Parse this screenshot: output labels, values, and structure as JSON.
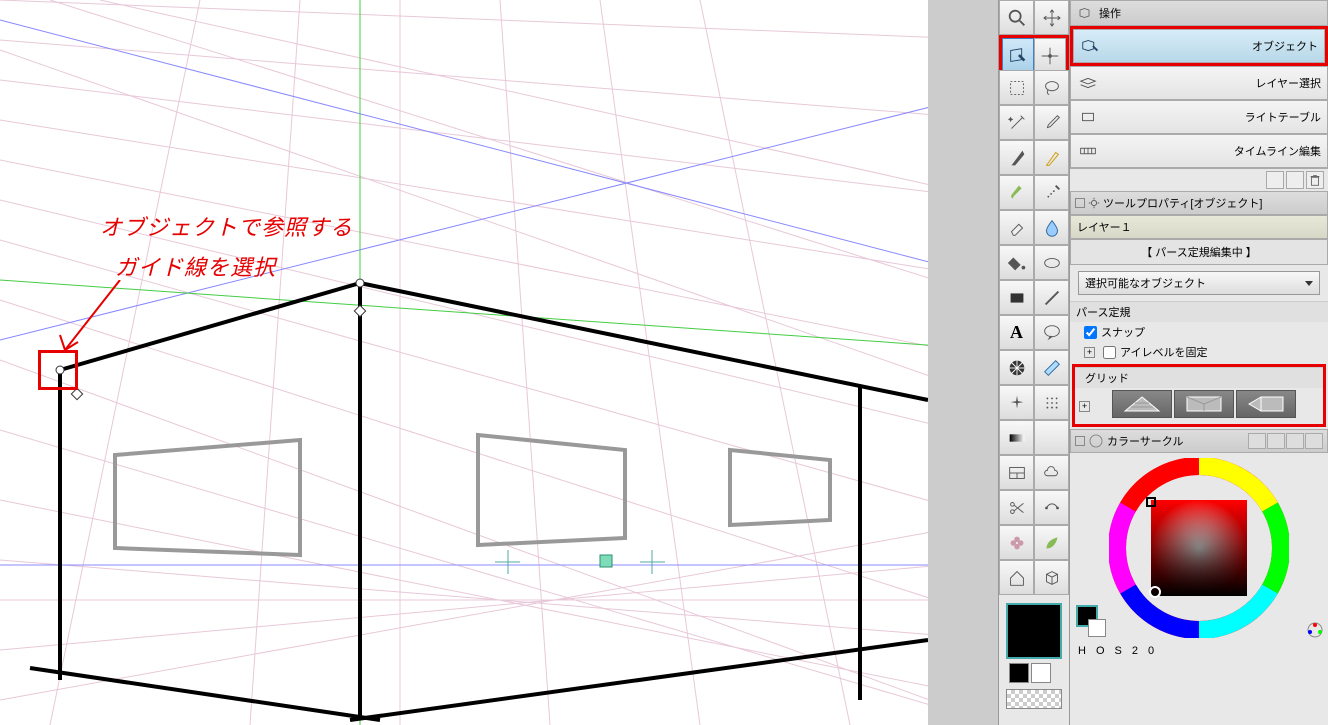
{
  "annotation": {
    "line1": "オブジェクトで参照する",
    "line2": "ガイド線を選択"
  },
  "panel_operation": {
    "title": "操作"
  },
  "subtools": {
    "object": "オブジェクト",
    "layer_select": "レイヤー選択",
    "light_table": "ライトテーブル",
    "timeline_edit": "タイムライン編集"
  },
  "tool_property": {
    "title": "ツールプロパティ[オブジェクト]"
  },
  "layer": {
    "name": "レイヤー１",
    "status": "【 パース定規編集中 】"
  },
  "dropdown": {
    "label": "選択可能なオブジェクト"
  },
  "perspective": {
    "title": "パース定規",
    "snap": "スナップ",
    "eye_level": "アイレベルを固定",
    "grid": "グリッド"
  },
  "color": {
    "title": "カラーサークル"
  },
  "hsv": {
    "h": "H",
    "o": "O",
    "s": "S",
    "two": "2",
    "zero": "0"
  }
}
